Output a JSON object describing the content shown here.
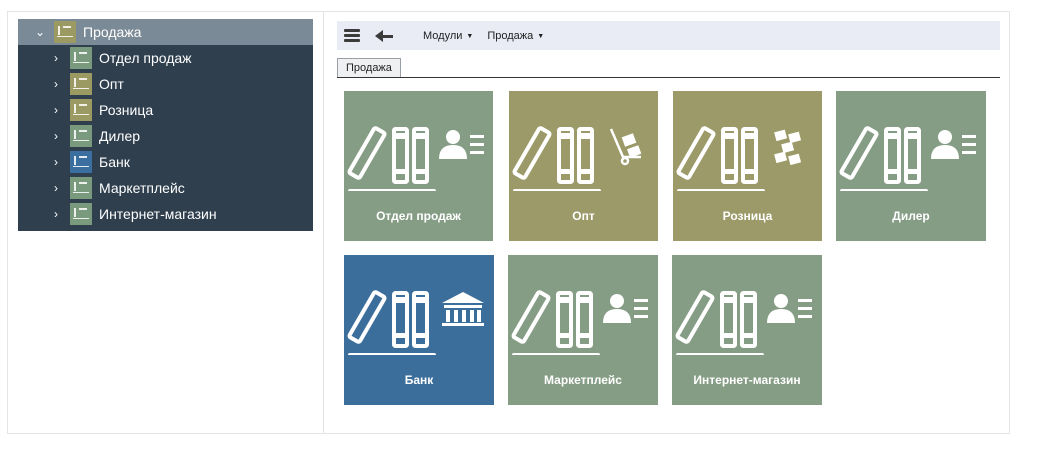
{
  "tree": {
    "root": {
      "label": "Продажа",
      "icon": "folder-icon",
      "color": "#7b8a97"
    },
    "items": [
      {
        "label": "Отдел продаж",
        "icon_color": "#7a9a7e"
      },
      {
        "label": "Опт",
        "icon_color": "#9a9a62"
      },
      {
        "label": "Розница",
        "icon_color": "#9a9a62"
      },
      {
        "label": "Дилер",
        "icon_color": "#7a9a7e"
      },
      {
        "label": "Банк",
        "icon_color": "#3a6fa0"
      },
      {
        "label": "Маркетплейс",
        "icon_color": "#7a9a7e"
      },
      {
        "label": "Интернет-магазин",
        "icon_color": "#7a9a7e"
      }
    ]
  },
  "toolbar": {
    "menu_icon": "hamburger-icon",
    "back_icon": "back-arrow-icon",
    "menus": [
      {
        "label": "Модули"
      },
      {
        "label": "Продажа"
      }
    ]
  },
  "tabs": [
    {
      "label": "Продажа",
      "active": true
    }
  ],
  "tiles": [
    {
      "label": "Отдел продаж",
      "color": "#869d85",
      "icon": "person-list-icon"
    },
    {
      "label": "Опт",
      "color": "#9b9a68",
      "icon": "hand-truck-icon"
    },
    {
      "label": "Розница",
      "color": "#9b9a68",
      "icon": "boxes-icon"
    },
    {
      "label": "Дилер",
      "color": "#869d85",
      "icon": "person-list-icon"
    },
    {
      "label": "Банк",
      "color": "#3c6e9b",
      "icon": "bank-icon"
    },
    {
      "label": "Маркетплейс",
      "color": "#869d85",
      "icon": "person-list-icon"
    },
    {
      "label": "Интернет-магазин",
      "color": "#869d85",
      "icon": "person-list-icon"
    }
  ]
}
